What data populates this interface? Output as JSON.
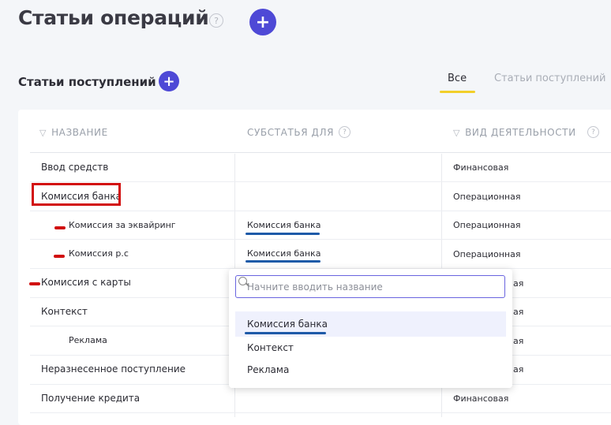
{
  "header": {
    "title": "Статьи операций",
    "help_glyph": "?",
    "add_glyph": "+"
  },
  "section": {
    "title": "Статьи поступлений",
    "add_glyph": "+"
  },
  "tabs": {
    "all": "Все",
    "income": "Статьи поступлений"
  },
  "table": {
    "col_name": "НАЗВАНИЕ",
    "col_parent": "СУБСТАТЬЯ ДЛЯ",
    "col_activity": "ВИД ДЕЯТЕЛЬНОСТИ",
    "filter_glyph": "▽",
    "rows": [
      {
        "name": "Ввод средств",
        "parent": "",
        "activity": "Финансовая"
      },
      {
        "name": "Комиссия банка",
        "parent": "",
        "activity": "Операционная"
      },
      {
        "name": "Комиссия за эквайринг",
        "parent": "Комиссия банка",
        "activity": "Операционная"
      },
      {
        "name": "Комиссия р.с",
        "parent": "Комиссия банка",
        "activity": "Операционная"
      },
      {
        "name": "Комиссия с карты",
        "parent": "",
        "activity": "ая"
      },
      {
        "name": "Контекст",
        "parent": "",
        "activity": "ая"
      },
      {
        "name": "Реклама",
        "parent": "",
        "activity": "ая"
      },
      {
        "name": "Неразнесенное поступление",
        "parent": "",
        "activity": "ая"
      },
      {
        "name": "Получение кредита",
        "parent": "",
        "activity": "Финансовая"
      }
    ]
  },
  "dropdown": {
    "placeholder": "Начните вводить название",
    "options": [
      "Комиссия банка",
      "Контекст",
      "Реклама"
    ]
  },
  "colors": {
    "accent": "#4e49d6",
    "tab_underline": "#f2cf2a",
    "annotation_red": "#d20e0e",
    "annotation_blue": "#1e5aa8"
  }
}
